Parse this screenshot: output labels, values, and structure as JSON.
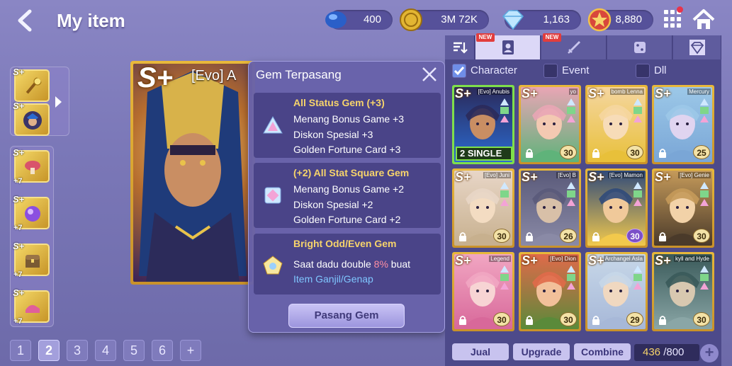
{
  "header": {
    "title": "My item",
    "currencies": [
      {
        "icon": "blue-gem-icon",
        "value": "400"
      },
      {
        "icon": "gold-coin-icon",
        "value": "3M 72K"
      },
      {
        "icon": "diamond-icon",
        "value": "1,163"
      },
      {
        "icon": "star-medal-icon",
        "value": "8,880"
      }
    ]
  },
  "big_card": {
    "rank": "S+",
    "name": "[Evo] A"
  },
  "popup": {
    "title": "Gem Terpasang",
    "gems": [
      {
        "name": "All Status Gem (+3)",
        "lines": [
          "Menang Bonus Game +3",
          "Diskon Spesial +3",
          "Golden Fortune Card +3"
        ]
      },
      {
        "name": "(+2) All Stat Square Gem",
        "lines": [
          "Menang Bonus Game +2",
          "Diskon Spesial +2",
          "Golden Fortune Card +2"
        ]
      },
      {
        "name": "Bright Odd/Even Gem",
        "desc_prefix": "Saat dadu double ",
        "desc_pct": "8%",
        "desc_suffix": " buat",
        "desc_link": "Item Ganjil/Genap"
      }
    ],
    "equip_button": "Pasang Gem"
  },
  "tabs": {
    "new_badge": "NEW"
  },
  "filters": [
    {
      "label": "Character",
      "checked": true
    },
    {
      "label": "Event",
      "checked": false
    },
    {
      "label": "Dll",
      "checked": false
    }
  ],
  "characters": [
    {
      "rank": "S+",
      "name": "[Evo] Anubis",
      "badge": "2 SINGLE",
      "selected": true
    },
    {
      "rank": "S+",
      "name": "yo",
      "level": "30"
    },
    {
      "rank": "S+",
      "name": "bomb Lenna",
      "level": "30"
    },
    {
      "rank": "S+",
      "name": "Mercury",
      "level": "25"
    },
    {
      "rank": "S+",
      "name": "[Evo] Juni",
      "level": "30"
    },
    {
      "rank": "S+",
      "name": "[Evo] B",
      "level": "26"
    },
    {
      "rank": "S+",
      "name": "[Evo] Mamon",
      "level": "30",
      "purple": true
    },
    {
      "rank": "S+",
      "name": "[Evo] Genie",
      "level": "30"
    },
    {
      "rank": "S+",
      "name": "Legend",
      "level": "30"
    },
    {
      "rank": "S+",
      "name": "[Evo] Dion",
      "level": "30"
    },
    {
      "rank": "S+",
      "name": "Archangel Asla",
      "level": "29"
    },
    {
      "rank": "S+",
      "name": "kyll and Hyde",
      "level": "30"
    }
  ],
  "bottom": {
    "sell": "Jual",
    "upgrade": "Upgrade",
    "combine": "Combine",
    "count_current": "436",
    "count_max": "/800"
  },
  "pager": [
    "1",
    "2",
    "3",
    "4",
    "5",
    "6"
  ],
  "pager_active": "2"
}
